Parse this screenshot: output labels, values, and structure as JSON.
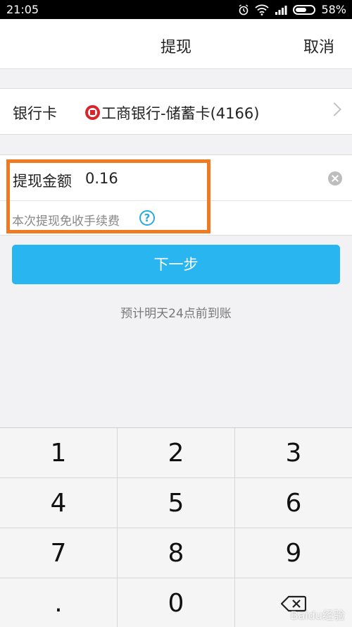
{
  "status_bar": {
    "time": "21:05",
    "battery_percent": "58%",
    "battery_level": 0.58
  },
  "nav": {
    "title": "提现",
    "cancel_label": "取消"
  },
  "bank_card": {
    "label": "银行卡",
    "value": "工商银行-储蓄卡(4166)"
  },
  "amount": {
    "label": "提现金额",
    "value": "0.16",
    "fee_note": "本次提现免收手续费",
    "help_symbol": "?"
  },
  "next_button": {
    "label": "下一步"
  },
  "arrival_note": "预计明天24点前到账",
  "keypad": {
    "keys": [
      "1",
      "2",
      "3",
      "4",
      "5",
      "6",
      "7",
      "8",
      "9",
      ".",
      "0"
    ],
    "backspace_icon": "backspace-icon"
  },
  "colors": {
    "accent_blue": "#29b6f0",
    "highlight_orange": "#f07a22",
    "bank_red": "#d8252c"
  },
  "watermark": "Baidu经验"
}
